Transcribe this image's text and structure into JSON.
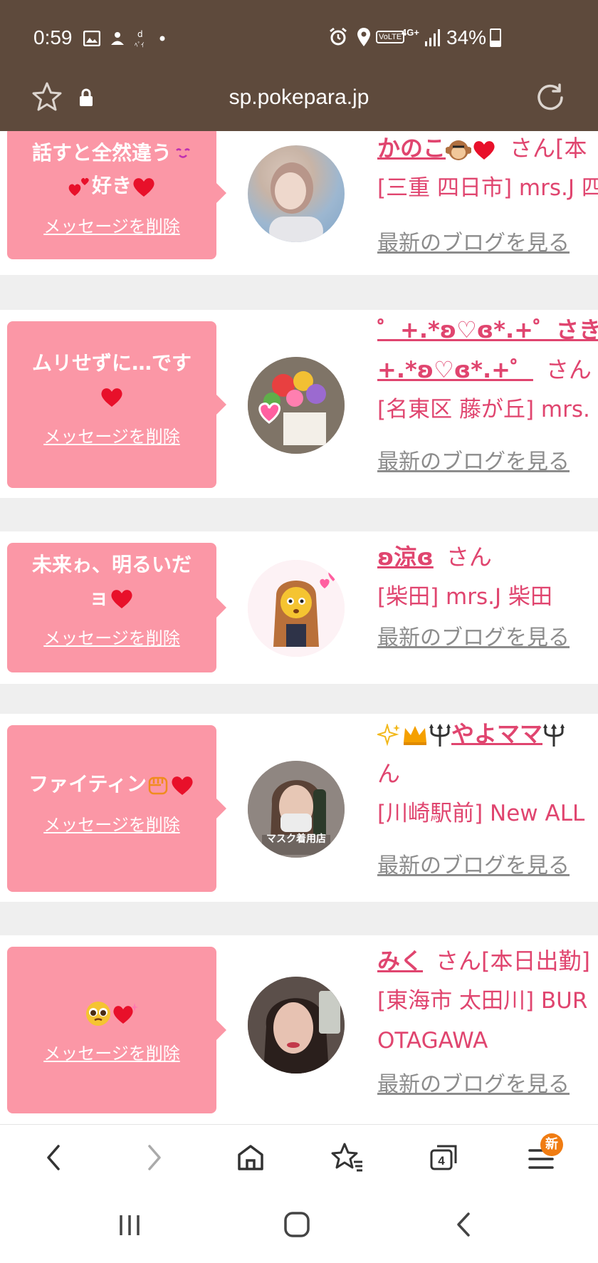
{
  "status_bar": {
    "time": "0:59",
    "battery": "34%",
    "battery_level": 0.34,
    "network": "4G+",
    "volte": "VoLTE"
  },
  "browser": {
    "url": "sp.pokepara.jp"
  },
  "delete_label": "メッセージを削除",
  "blog_label": "最新のブログを見る",
  "cards": [
    {
      "message_line1": "話すと全然違う",
      "message_line2": "好き",
      "name": "かのこ",
      "san": "さん[本",
      "shop": "[三重 四日市] mrs.J 四"
    },
    {
      "message_line1": "ムリせずに…です",
      "name": "゜+.*ʚ♡ɞ*.+゜さき゜",
      "name_line2": "+.*ʚ♡ɞ*.+゜",
      "san": "さん",
      "shop": "[名東区 藤が丘] mrs."
    },
    {
      "message_line1": "未来ゎ、明るいだ",
      "message_line2": "ョ",
      "name": "ʚ涼ɞ",
      "san": "さん",
      "shop": "[柴田] mrs.J 柴田"
    },
    {
      "message_line1": "ファイティン",
      "name": "やよママ",
      "name_line2": "ん",
      "shop": "[川崎駅前] New ALL",
      "avatar_caption": "マスク着用店"
    },
    {
      "name": "みく",
      "san": "さん[本日出勤]",
      "shop": "[東海市 太田川] BUR",
      "shop_line2": "OTAGAWA"
    }
  ],
  "bottom_nav": {
    "tabs_count": "4",
    "badge": "新"
  }
}
